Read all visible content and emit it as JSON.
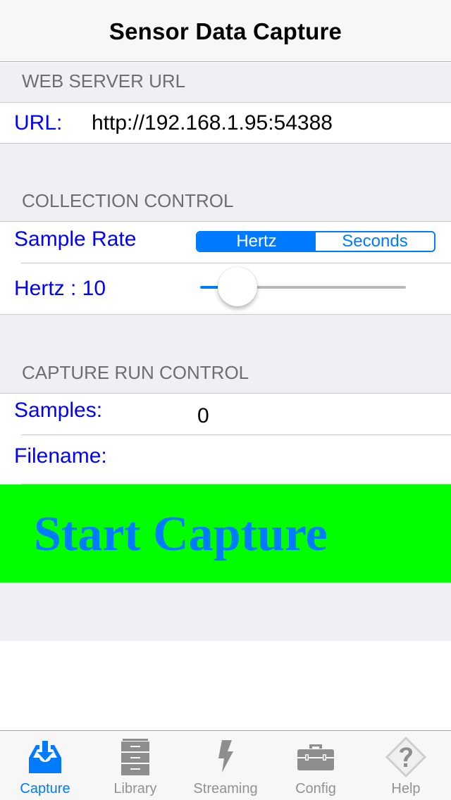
{
  "navbar": {
    "title": "Sensor Data Capture"
  },
  "sections": {
    "web_server": {
      "header": "WEB SERVER URL",
      "url_label": "URL:",
      "url_value": "http://192.168.1.95:54388"
    },
    "collection": {
      "header": "COLLECTION CONTROL",
      "sample_rate_label": "Sample Rate",
      "segments": [
        {
          "label": "Hertz",
          "selected": true
        },
        {
          "label": "Seconds",
          "selected": false
        }
      ],
      "rate_label": "Hertz  : 10",
      "slider": {
        "value": 10,
        "fraction": 0.13
      }
    },
    "capture": {
      "header": "CAPTURE RUN CONTROL",
      "samples_label": "Samples:",
      "samples_value": "0",
      "filename_label": "Filename:",
      "filename_value": ""
    }
  },
  "start_button": {
    "label": "Start Capture",
    "bg_color": "#00ff00",
    "text_color": "#007aff"
  },
  "tabbar": {
    "items": [
      {
        "label": "Capture",
        "icon": "inbox-download-icon",
        "active": true
      },
      {
        "label": "Library",
        "icon": "file-cabinet-icon",
        "active": false
      },
      {
        "label": "Streaming",
        "icon": "lightning-bolt-icon",
        "active": false
      },
      {
        "label": "Config",
        "icon": "toolbox-icon",
        "active": false
      },
      {
        "label": "Help",
        "icon": "question-diamond-icon",
        "active": false
      }
    ]
  },
  "colors": {
    "accent": "#007aff",
    "label_blue": "#0000ff",
    "group_bg": "#efeff4",
    "tab_inactive": "#929292"
  }
}
